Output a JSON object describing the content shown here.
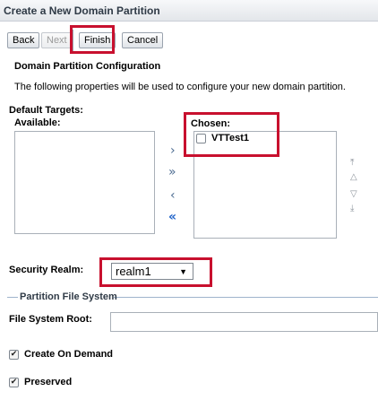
{
  "window": {
    "title": "Create a New Domain Partition"
  },
  "toolbar": {
    "back": "Back",
    "next": "Next",
    "finish": "Finish",
    "cancel": "Cancel"
  },
  "config": {
    "heading": "Domain Partition Configuration",
    "description": "The following properties will be used to configure your new domain partition."
  },
  "targets": {
    "section_label": "Default Targets:",
    "available_label": "Available:",
    "chosen_label": "Chosen:",
    "chosen_items": [
      "VTTest1"
    ],
    "move_icons": [
      "chevron-right-icon",
      "double-chevron-right-icon",
      "chevron-left-icon",
      "double-chevron-left-icon"
    ]
  },
  "security": {
    "label": "Security Realm:",
    "selected": "realm1"
  },
  "file_system": {
    "legend": "Partition File System",
    "root_label": "File System Root:",
    "root_value": "",
    "create_on_demand_label": "Create On Demand",
    "create_on_demand": true,
    "preserved_label": "Preserved",
    "preserved": true
  },
  "colors": {
    "highlight": "#c8102e",
    "accent": "#1f63c9"
  }
}
